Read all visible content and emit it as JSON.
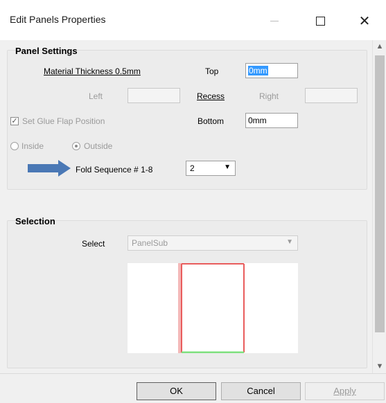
{
  "window": {
    "title": "Edit Panels Properties",
    "minimize_label": "—",
    "close_label": "✕"
  },
  "panel_settings": {
    "heading": "Panel Settings",
    "material_thickness": "Material Thickness 0.5mm",
    "top_label": "Top",
    "top_value": "0mm",
    "left_label": "Left",
    "left_value": "",
    "recess_label": "Recess",
    "right_label": "Right",
    "right_value": "",
    "glue_flap_label": "Set Glue Flap Position",
    "glue_flap_checked": true,
    "bottom_label": "Bottom",
    "bottom_value": "0mm",
    "inside_label": "Inside",
    "outside_label": "Outside",
    "outside_selected": true,
    "fold_label": "Fold Sequence # 1-8",
    "fold_value": "2"
  },
  "selection": {
    "heading": "Selection",
    "select_label": "Select",
    "select_value": "PanelSub"
  },
  "buttons": {
    "ok": "OK",
    "cancel": "Cancel",
    "apply": "Apply"
  },
  "colors": {
    "arrow": "#4a78b5",
    "outline_red": "#e95c5c",
    "outline_green": "#7fe07f",
    "highlight": "#3399ff"
  }
}
